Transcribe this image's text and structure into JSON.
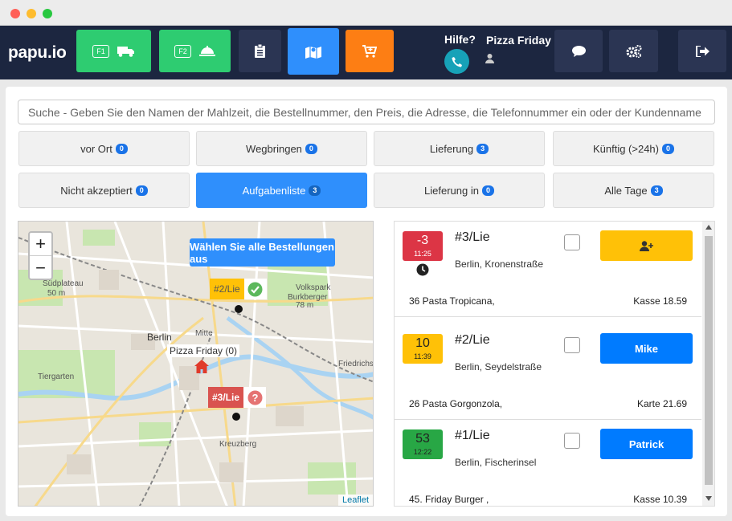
{
  "app": {
    "logo": "papu.io",
    "help_label": "Hilfe?",
    "restaurant": "Pizza Friday"
  },
  "nav": {
    "f1_key": "F1",
    "f2_key": "F2"
  },
  "search": {
    "placeholder": "Suche - Geben Sie den Namen der Mahlzeit, die Bestellnummer, den Preis, die Adresse, die Telefonnummer ein oder der Kundenname"
  },
  "filters": [
    {
      "label": "vor Ort",
      "count": "0"
    },
    {
      "label": "Wegbringen",
      "count": "0"
    },
    {
      "label": "Lieferung",
      "count": "3"
    },
    {
      "label": "Künftig (>24h)",
      "count": "0"
    },
    {
      "label": "Nicht akzeptiert",
      "count": "0"
    },
    {
      "label": "Aufgabenliste",
      "count": "3",
      "active": true
    },
    {
      "label": "Lieferung in",
      "count": "0"
    },
    {
      "label": "Alle Tage",
      "count": "3"
    }
  ],
  "map": {
    "zoom_in": "+",
    "zoom_out": "−",
    "select_all": "Wählen Sie alle Bestellungen aus",
    "restaurant_label": "Pizza Friday (0)",
    "attribution": "Leaflet",
    "places": {
      "a": "Südplateau",
      "b": "50 m",
      "c": "Mitte",
      "d": "Berlin",
      "e": "Tiergarten",
      "f": "Kreuzberg",
      "g": "Friedrichsh",
      "h": "Volkspark",
      "i": "Burkberger",
      "j": "78 m"
    },
    "markers": [
      {
        "label": "#2/Lie",
        "color": "#ffc107",
        "status": "check"
      },
      {
        "label": "#3/Lie",
        "color": "#d9534f",
        "status": "question"
      }
    ]
  },
  "orders": [
    {
      "time_big": "-3",
      "time_small": "11:25",
      "time_color": "#dc3545",
      "number": "#3/Lie",
      "address": "Berlin, Kronenstraße",
      "items": "36 Pasta Tropicana,",
      "payment": "Kasse 18.59",
      "assignee": "",
      "assign_color": "#ffc107",
      "late": true
    },
    {
      "time_big": "10",
      "time_small": "11:39",
      "time_color": "#ffc107",
      "number": "#2/Lie",
      "address": "Berlin, Seydelstraße",
      "items": "26 Pasta Gorgonzola,",
      "payment": "Karte 21.69",
      "assignee": "Mike",
      "assign_color": "#007bff"
    },
    {
      "time_big": "53",
      "time_small": "12:22",
      "time_color": "#28a745",
      "number": "#1/Lie",
      "address": "Berlin, Fischerinsel",
      "items": "45. Friday Burger ,",
      "payment": "Kasse 10.39",
      "assignee": "Patrick",
      "assign_color": "#007bff"
    }
  ],
  "colors": {
    "navbar": "#1c2640",
    "green": "#2ecc71",
    "blue": "#2f8ffc",
    "orange": "#fd7e14",
    "navy_btn": "#2b3553"
  }
}
